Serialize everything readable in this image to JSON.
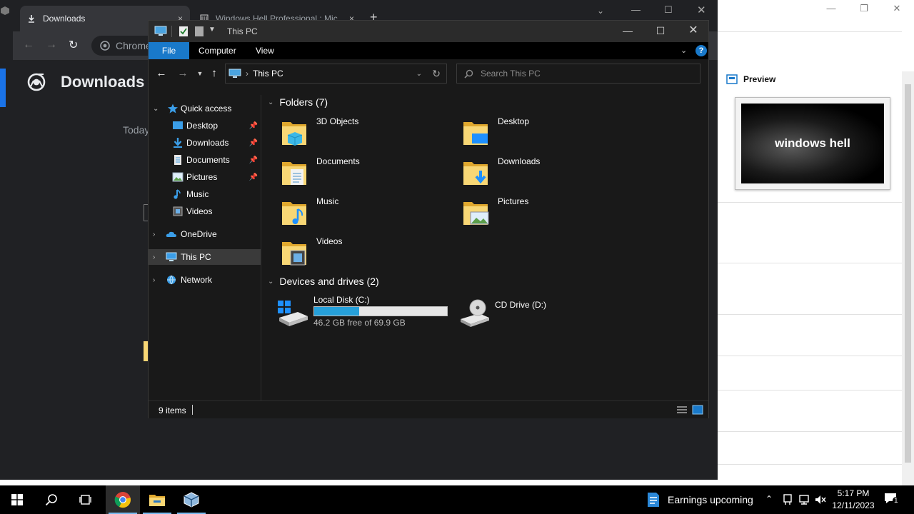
{
  "right_app": {
    "preview_label": "Preview",
    "preview_image_text": "windows hell"
  },
  "chrome": {
    "tabs": [
      {
        "label": "Downloads",
        "close": "×"
      },
      {
        "label": "Windows Hell Professional : Mic",
        "close": "×"
      }
    ],
    "new_tab": "+",
    "address_text": "Chrome",
    "page_title": "Downloads",
    "today_label": "Today"
  },
  "explorer": {
    "window_title": "This PC",
    "ribbon_tabs": [
      "File",
      "Computer",
      "View"
    ],
    "address": "This PC",
    "search_placeholder": "Search This PC",
    "sidebar": {
      "quick_access": "Quick access",
      "quick_items": [
        "Desktop",
        "Downloads",
        "Documents",
        "Pictures",
        "Music",
        "Videos"
      ],
      "onedrive": "OneDrive",
      "this_pc": "This PC",
      "network": "Network"
    },
    "folders_header": "Folders (7)",
    "folders": [
      "3D Objects",
      "Desktop",
      "Documents",
      "Downloads",
      "Music",
      "Pictures",
      "Videos"
    ],
    "drives_header": "Devices and drives (2)",
    "drives": [
      {
        "name": "Local Disk (C:)",
        "free_text": "46.2 GB free of 69.9 GB",
        "used_fraction": 0.34
      },
      {
        "name": "CD Drive (D:)"
      }
    ],
    "status_items": "9 items"
  },
  "taskbar": {
    "news_text": "Earnings upcoming",
    "time": "5:17 PM",
    "date": "12/11/2023",
    "notification_count": "1"
  },
  "colors": {
    "accent": "#1979ca",
    "drive_bar": "#26a0da",
    "folder_yellow": "#f8d775",
    "folder_dark": "#e0a82e"
  }
}
